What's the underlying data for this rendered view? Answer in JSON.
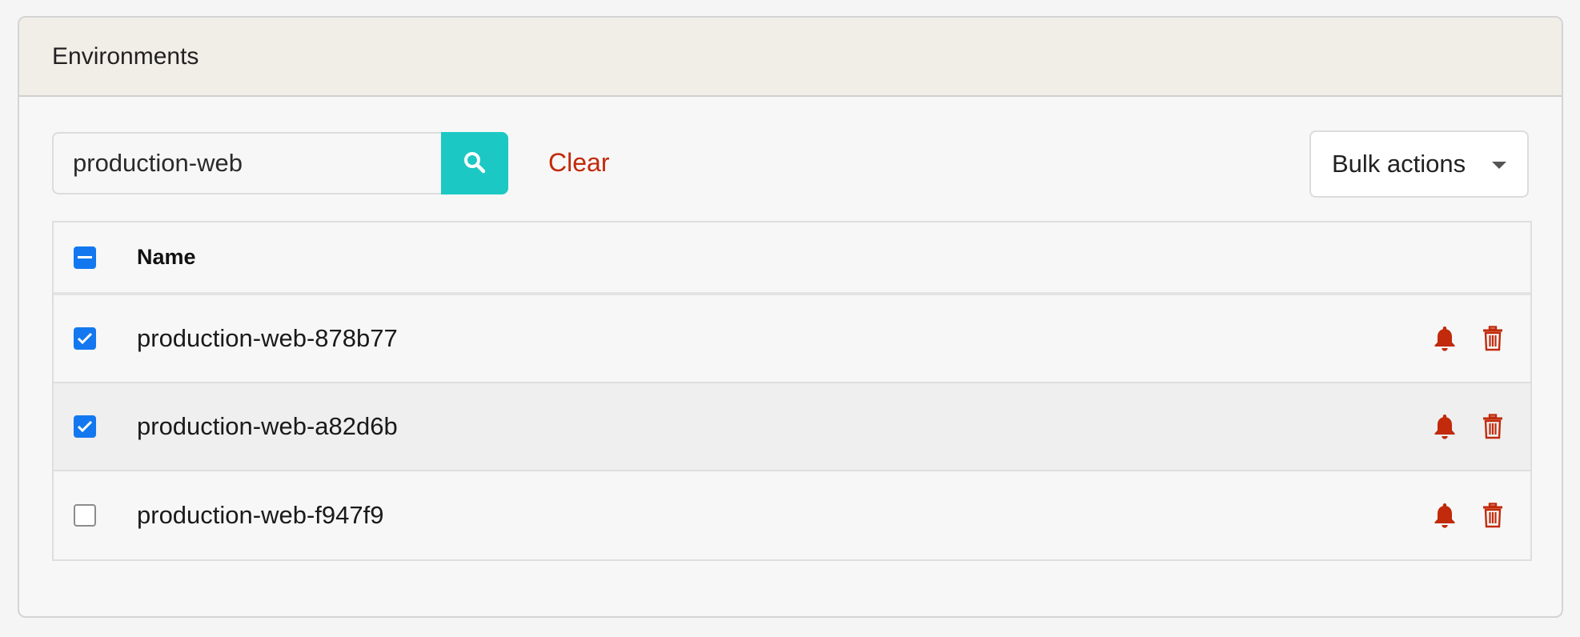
{
  "panel": {
    "title": "Environments"
  },
  "search": {
    "value": "production-web",
    "placeholder": ""
  },
  "toolbar": {
    "clear_label": "Clear",
    "bulk_actions_label": "Bulk actions"
  },
  "table": {
    "header": {
      "name": "Name",
      "select_all_state": "indeterminate"
    },
    "rows": [
      {
        "name": "production-web-878b77",
        "checked": true
      },
      {
        "name": "production-web-a82d6b",
        "checked": true
      },
      {
        "name": "production-web-f947f9",
        "checked": false
      }
    ]
  },
  "icons": {
    "search": "search-icon",
    "notify": "bell-icon",
    "delete": "trash-icon"
  },
  "colors": {
    "accent": "#1bc8c4",
    "danger": "#c12a0a",
    "checkbox": "#1378f0",
    "header_bg": "#f1eee8"
  }
}
